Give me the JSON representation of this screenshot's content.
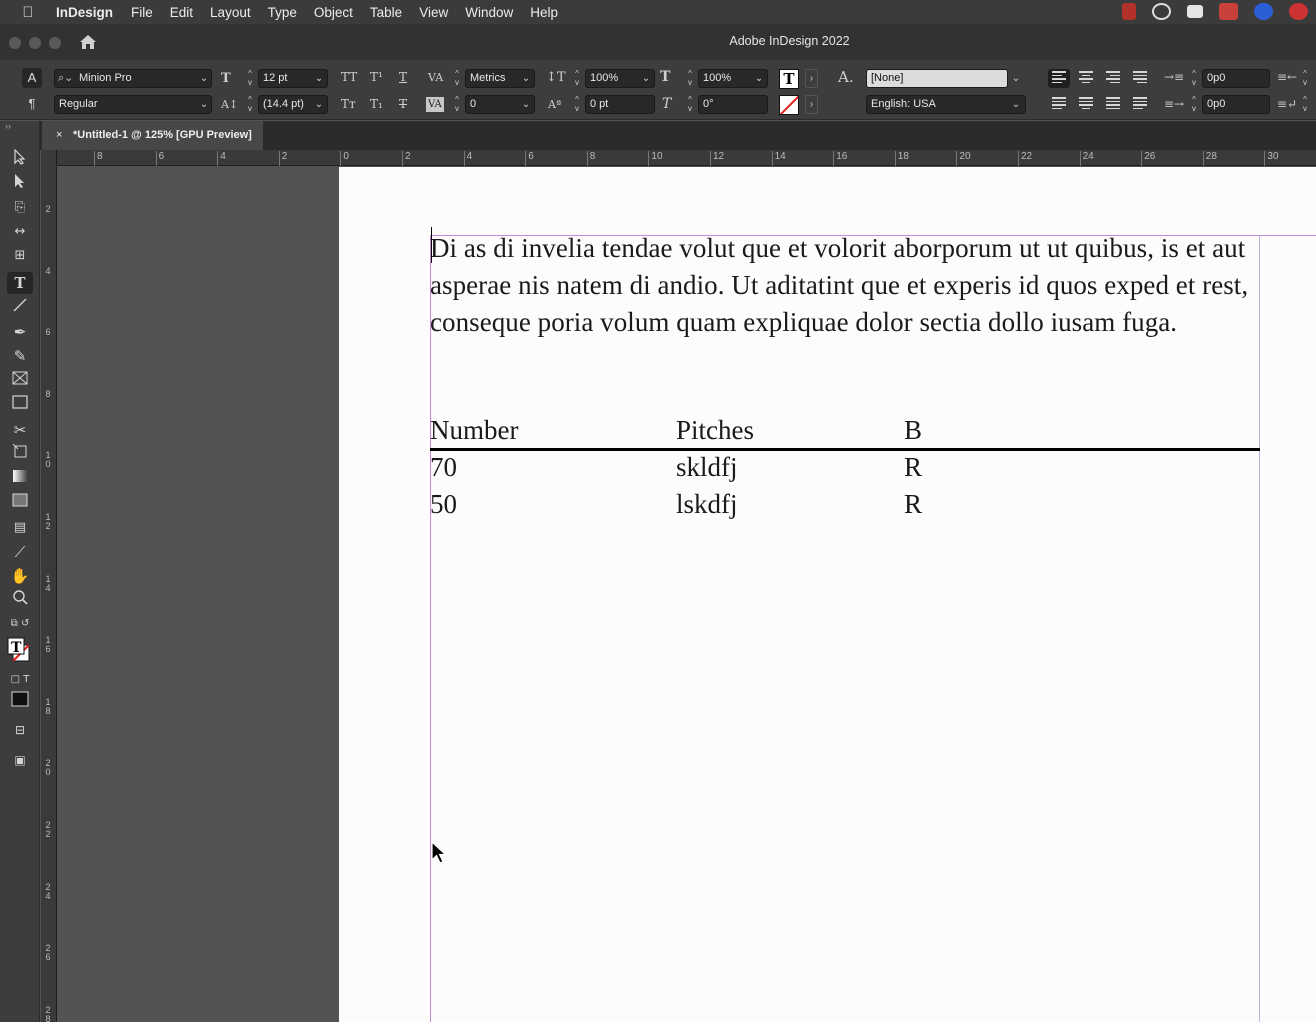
{
  "menubar": {
    "apple": "",
    "app_name": "InDesign",
    "items": [
      "File",
      "Edit",
      "Layout",
      "Type",
      "Object",
      "Table",
      "View",
      "Window",
      "Help"
    ]
  },
  "window": {
    "title": "Adobe InDesign 2022"
  },
  "control_panel": {
    "font_family": "Minion Pro",
    "font_style": "Regular",
    "font_size": "12 pt",
    "leading": "(14.4 pt)",
    "kerning": "Metrics",
    "tracking": "0",
    "vertical_scale": "100%",
    "horizontal_scale": "100%",
    "baseline_shift": "0 pt",
    "skew": "0°",
    "char_style": "[None]",
    "language": "English: USA",
    "left_indent": "0p0",
    "right_indent": "0p0"
  },
  "tab": {
    "title": "*Untitled-1 @ 125% [GPU Preview]",
    "close": "×"
  },
  "rulers": {
    "h_labels": [
      "8",
      "6",
      "4",
      "2",
      "0",
      "2",
      "4",
      "6",
      "8",
      "10",
      "12",
      "14",
      "16",
      "18",
      "20",
      "22",
      "24",
      "26",
      "28",
      "30"
    ],
    "v_labels": [
      "2",
      "4",
      "6",
      "8",
      "10",
      "12",
      "14",
      "16",
      "18",
      "20",
      "22",
      "24",
      "26",
      "28"
    ]
  },
  "document": {
    "paragraph": "Di as di invelia tendae volut que et volorit aborporum ut ut quibus, is et aut asperae nis natem di andio. Ut aditatint que et experis id quos exped et rest, conseque poria volum quam expliquae dolor sectia dollo iusam fuga.",
    "table": {
      "headers": [
        "Number",
        "Pitches",
        "B"
      ],
      "rows": [
        [
          "70",
          "skldfj",
          "R"
        ],
        [
          "50",
          "lskdfj",
          "R"
        ]
      ]
    }
  },
  "colors": {
    "chrome_dark": "#3d3d3d",
    "pasteboard": "#535353",
    "page": "#fcfcfb",
    "margin_guide": "#c985e0"
  }
}
